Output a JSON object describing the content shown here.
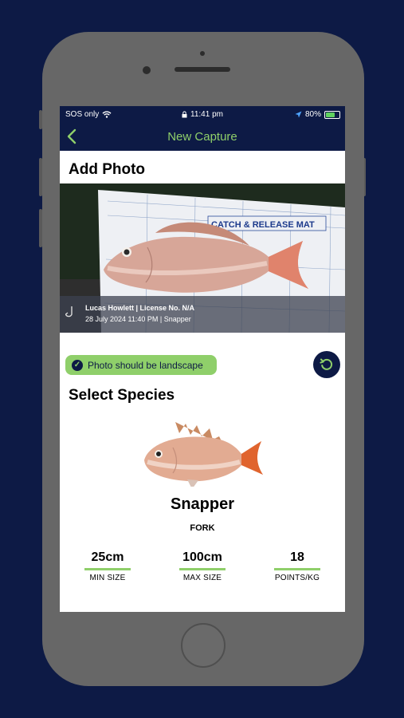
{
  "status_bar": {
    "carrier": "SOS only",
    "time": "11:41 pm",
    "battery": "80%",
    "battery_level": 0.8
  },
  "nav": {
    "back_icon": "chevron-left-icon",
    "title": "New Capture"
  },
  "add_photo": {
    "title": "Add Photo",
    "mat_text": "CATCH & RELEASE MAT",
    "overlay_line1": "Lucas Howlett | License No. N/A",
    "overlay_line2": "28 July 2024 11:40 PM | Snapper"
  },
  "badge": {
    "text": "Photo should be landscape"
  },
  "species": {
    "section_title": "Select Species",
    "name": "Snapper",
    "measurement": "FORK",
    "stats": [
      {
        "value": "25cm",
        "label": "MIN SIZE"
      },
      {
        "value": "100cm",
        "label": "MAX SIZE"
      },
      {
        "value": "18",
        "label": "POINTS/KG"
      }
    ]
  },
  "colors": {
    "navy": "#0d1a45",
    "accent_green": "#8fcf6a"
  }
}
